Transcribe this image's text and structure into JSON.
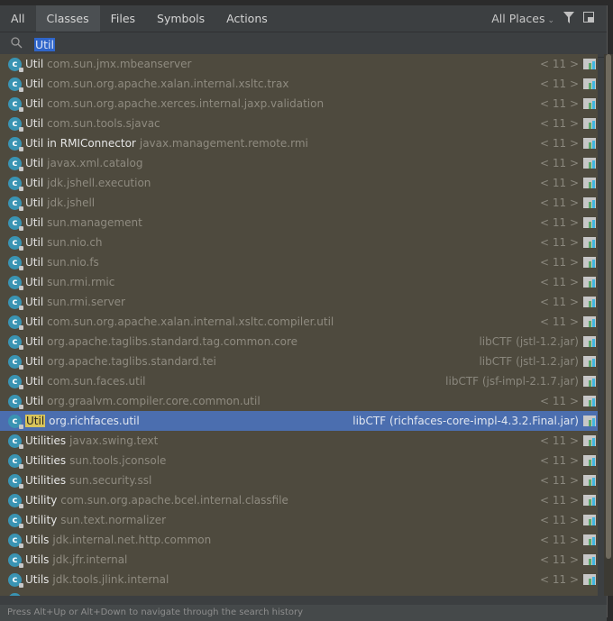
{
  "tabs": [
    "All",
    "Classes",
    "Files",
    "Symbols",
    "Actions"
  ],
  "active_tab": "Classes",
  "places": "All Places",
  "search": {
    "value": "Util"
  },
  "results": [
    {
      "name": "Util",
      "pkg": "com.sun.jmx.mbeanserver",
      "loc": "< 11 >"
    },
    {
      "name": "Util",
      "pkg": "com.sun.org.apache.xalan.internal.xsltc.trax",
      "loc": "< 11 >"
    },
    {
      "name": "Util",
      "pkg": "com.sun.org.apache.xerces.internal.jaxp.validation",
      "loc": "< 11 >"
    },
    {
      "name": "Util",
      "pkg": "com.sun.tools.sjavac",
      "loc": "< 11 >"
    },
    {
      "name": "Util in RMIConnector",
      "pkg": "javax.management.remote.rmi",
      "loc": "< 11 >"
    },
    {
      "name": "Util",
      "pkg": "javax.xml.catalog",
      "loc": "< 11 >"
    },
    {
      "name": "Util",
      "pkg": "jdk.jshell.execution",
      "loc": "< 11 >"
    },
    {
      "name": "Util",
      "pkg": "jdk.jshell",
      "loc": "< 11 >"
    },
    {
      "name": "Util",
      "pkg": "sun.management",
      "loc": "< 11 >"
    },
    {
      "name": "Util",
      "pkg": "sun.nio.ch",
      "loc": "< 11 >"
    },
    {
      "name": "Util",
      "pkg": "sun.nio.fs",
      "loc": "< 11 >"
    },
    {
      "name": "Util",
      "pkg": "sun.rmi.rmic",
      "loc": "< 11 >"
    },
    {
      "name": "Util",
      "pkg": "sun.rmi.server",
      "loc": "< 11 >"
    },
    {
      "name": "Util",
      "pkg": "com.sun.org.apache.xalan.internal.xsltc.compiler.util",
      "loc": "< 11 >"
    },
    {
      "name": "Util",
      "pkg": "org.apache.taglibs.standard.tag.common.core",
      "loc": "libCTF (jstl-1.2.jar)"
    },
    {
      "name": "Util",
      "pkg": "org.apache.taglibs.standard.tei",
      "loc": "libCTF (jstl-1.2.jar)"
    },
    {
      "name": "Util",
      "pkg": "com.sun.faces.util",
      "loc": "libCTF (jsf-impl-2.1.7.jar)"
    },
    {
      "name": "Util",
      "pkg": "org.graalvm.compiler.core.common.util",
      "loc": "< 11 >"
    },
    {
      "name": "Util",
      "pkg": "org.richfaces.util",
      "loc": "libCTF (richfaces-core-impl-4.3.2.Final.jar)",
      "selected": true
    },
    {
      "name": "Utilities",
      "pkg": "javax.swing.text",
      "loc": "< 11 >"
    },
    {
      "name": "Utilities",
      "pkg": "sun.tools.jconsole",
      "loc": "< 11 >"
    },
    {
      "name": "Utilities",
      "pkg": "sun.security.ssl",
      "loc": "< 11 >"
    },
    {
      "name": "Utility",
      "pkg": "com.sun.org.apache.bcel.internal.classfile",
      "loc": "< 11 >"
    },
    {
      "name": "Utility",
      "pkg": "sun.text.normalizer",
      "loc": "< 11 >"
    },
    {
      "name": "Utils",
      "pkg": "jdk.internal.net.http.common",
      "loc": "< 11 >"
    },
    {
      "name": "Utils",
      "pkg": "jdk.jfr.internal",
      "loc": "< 11 >"
    },
    {
      "name": "Utils",
      "pkg": "jdk.tools.jlink.internal",
      "loc": "< 11 >"
    }
  ],
  "footer": "Press Alt+Up or Alt+Down to navigate through the search history",
  "colors": {
    "selection": "#4b6eaf",
    "list_bg": "#4e4a3e",
    "highlight": "#d9c55a"
  }
}
